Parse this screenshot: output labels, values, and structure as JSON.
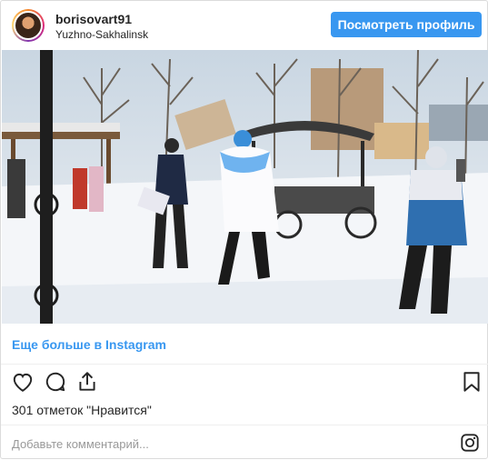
{
  "header": {
    "username": "borisovart91",
    "location": "Yuzhno-Sakhalinsk",
    "view_profile_label": "Посмотреть профиль"
  },
  "media": {
    "icons": [
      "video-frame"
    ]
  },
  "more_link": "Еще больше в Instagram",
  "actions": {
    "icons": [
      "heart-icon",
      "comment-icon",
      "share-icon",
      "bookmark-icon"
    ]
  },
  "likes_text": "301 отметок \"Нравится\"",
  "comment": {
    "placeholder": "Добавьте комментарий...",
    "icon": "instagram-icon"
  },
  "colors": {
    "accent": "#3897f0",
    "text": "#262626",
    "muted": "#999999",
    "divider": "#efefef"
  }
}
